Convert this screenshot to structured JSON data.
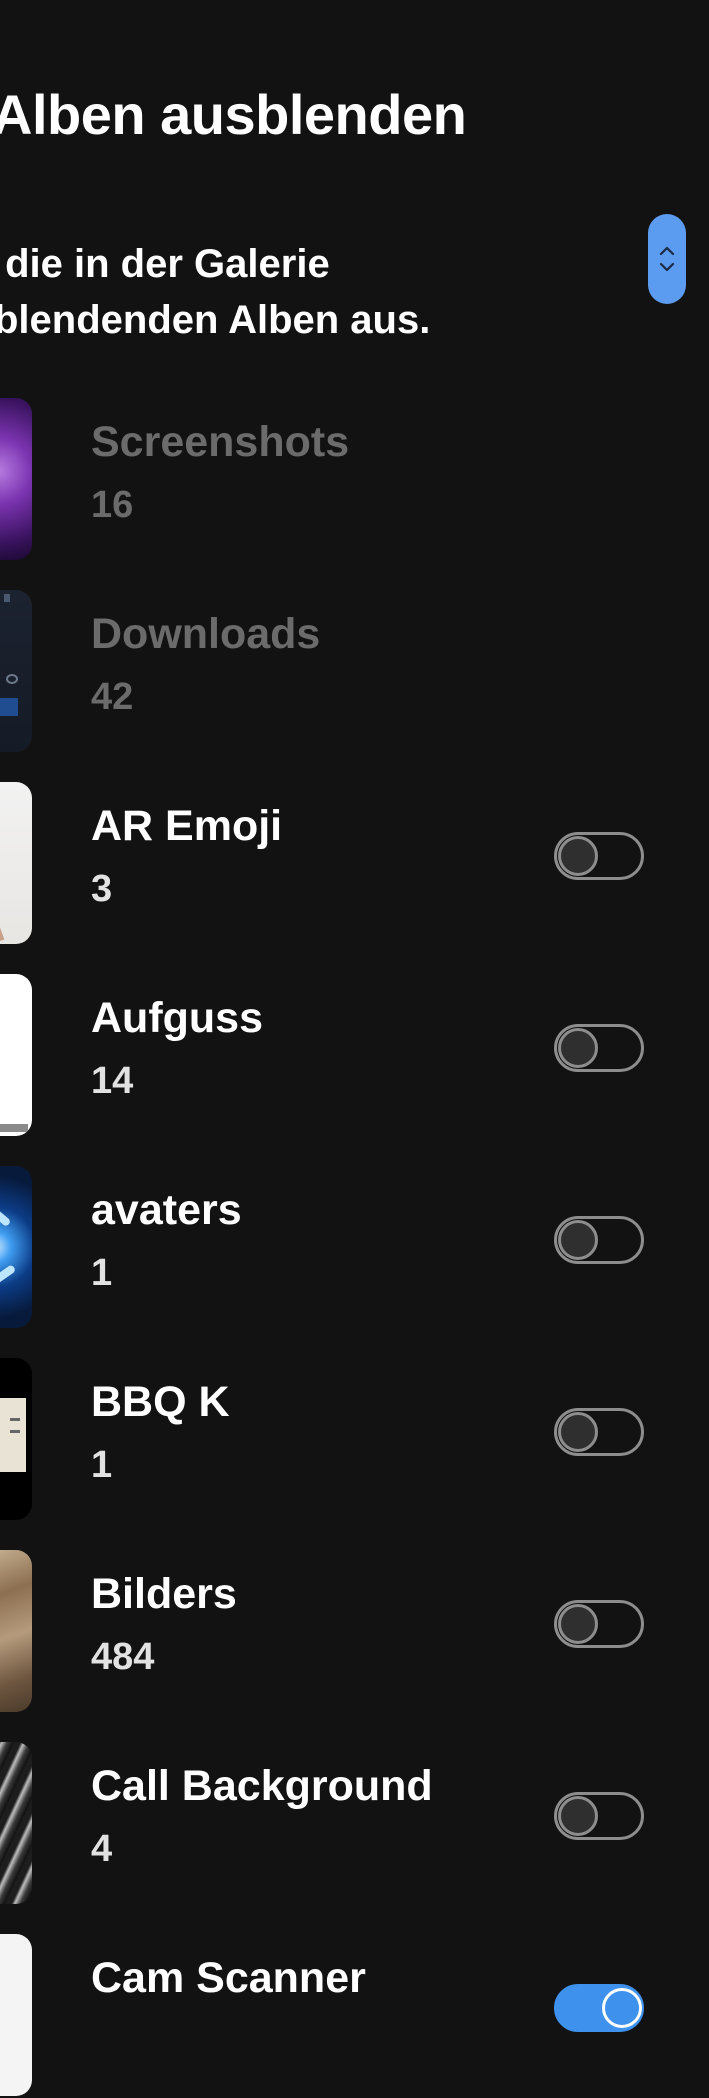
{
  "header": {
    "title": "Alben ausblenden",
    "description_line1": " die in der Galerie",
    "description_line2": "blendenden Alben aus."
  },
  "albums": [
    {
      "name": "Screenshots",
      "count": "16",
      "toggle_visible": false,
      "enabled": false
    },
    {
      "name": "Downloads",
      "count": "42",
      "toggle_visible": false,
      "enabled": false
    },
    {
      "name": "AR Emoji",
      "count": "3",
      "toggle_visible": true,
      "enabled": true,
      "hidden": false
    },
    {
      "name": "Aufguss",
      "count": "14",
      "toggle_visible": true,
      "enabled": true,
      "hidden": false
    },
    {
      "name": "avaters",
      "count": "1",
      "toggle_visible": true,
      "enabled": true,
      "hidden": false
    },
    {
      "name": "BBQ K",
      "count": "1",
      "toggle_visible": true,
      "enabled": true,
      "hidden": false
    },
    {
      "name": "Bilders",
      "count": "484",
      "toggle_visible": true,
      "enabled": true,
      "hidden": false
    },
    {
      "name": "Call Background",
      "count": "4",
      "toggle_visible": true,
      "enabled": true,
      "hidden": false
    },
    {
      "name": "Cam Scanner",
      "count": "",
      "toggle_visible": true,
      "enabled": true,
      "hidden": true
    }
  ],
  "colors": {
    "background": "#121212",
    "accent": "#3e91ec",
    "scroll_indicator": "#5b9cf0",
    "disabled_text": "#6b6b6b"
  },
  "icons": {
    "scroll_up": "chevron-up-icon",
    "scroll_down": "chevron-down-icon"
  }
}
